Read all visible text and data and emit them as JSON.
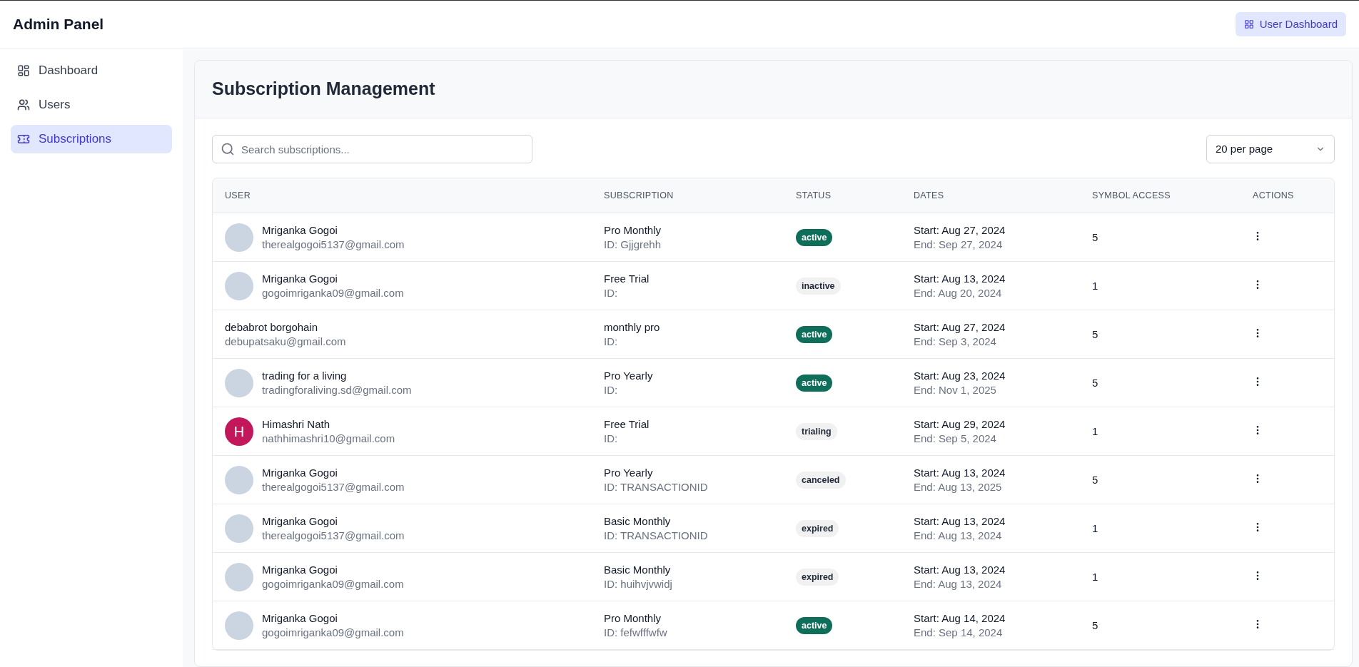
{
  "app": {
    "title": "Admin Panel",
    "header_button": "User Dashboard"
  },
  "sidebar": {
    "items": [
      {
        "label": "Dashboard",
        "selected": false
      },
      {
        "label": "Users",
        "selected": false
      },
      {
        "label": "Subscriptions",
        "selected": true
      }
    ]
  },
  "page": {
    "title": "Subscription Management",
    "search": {
      "placeholder": "Search subscriptions..."
    },
    "per_page": "20 per page"
  },
  "table": {
    "columns": [
      "USER",
      "SUBSCRIPTION",
      "STATUS",
      "DATES",
      "SYMBOL ACCESS",
      "ACTIONS"
    ],
    "rows": [
      {
        "avatar": {
          "kind": "photo"
        },
        "name": "Mriganka Gogoi",
        "email": "therealgogoi5137@gmail.com",
        "plan": "Pro Monthly",
        "plan_id": "ID: Gjjgrehh",
        "status": {
          "label": "active",
          "kind": "success"
        },
        "start": "Start: Aug 27, 2024",
        "end": "End: Sep 27, 2024",
        "symbol_access": "5"
      },
      {
        "avatar": {
          "kind": "photo"
        },
        "name": "Mriganka Gogoi",
        "email": "gogoimriganka09@gmail.com",
        "plan": "Free Trial",
        "plan_id": "ID:",
        "status": {
          "label": "inactive",
          "kind": "neutral"
        },
        "start": "Start: Aug 13, 2024",
        "end": "End: Aug 20, 2024",
        "symbol_access": "1"
      },
      {
        "avatar": {
          "kind": "none"
        },
        "name": "debabrot borgohain",
        "email": "debupatsaku@gmail.com",
        "plan": "monthly pro",
        "plan_id": "ID:",
        "status": {
          "label": "active",
          "kind": "success"
        },
        "start": "Start: Aug 27, 2024",
        "end": "End: Sep 3, 2024",
        "symbol_access": "5"
      },
      {
        "avatar": {
          "kind": "photo"
        },
        "name": "trading for a living",
        "email": "tradingforaliving.sd@gmail.com",
        "plan": "Pro Yearly",
        "plan_id": "ID:",
        "status": {
          "label": "active",
          "kind": "success"
        },
        "start": "Start: Aug 23, 2024",
        "end": "End: Nov 1, 2025",
        "symbol_access": "5"
      },
      {
        "avatar": {
          "kind": "initial",
          "letter": "H",
          "color": "#c2185b"
        },
        "name": "Himashri Nath",
        "email": "nathhimashri10@gmail.com",
        "plan": "Free Trial",
        "plan_id": "ID:",
        "status": {
          "label": "trialing",
          "kind": "neutral"
        },
        "start": "Start: Aug 29, 2024",
        "end": "End: Sep 5, 2024",
        "symbol_access": "1"
      },
      {
        "avatar": {
          "kind": "photo"
        },
        "name": "Mriganka Gogoi",
        "email": "therealgogoi5137@gmail.com",
        "plan": "Pro Yearly",
        "plan_id": "ID: TRANSACTIONID",
        "status": {
          "label": "canceled",
          "kind": "neutral"
        },
        "start": "Start: Aug 13, 2024",
        "end": "End: Aug 13, 2025",
        "symbol_access": "5"
      },
      {
        "avatar": {
          "kind": "photo"
        },
        "name": "Mriganka Gogoi",
        "email": "therealgogoi5137@gmail.com",
        "plan": "Basic Monthly",
        "plan_id": "ID: TRANSACTIONID",
        "status": {
          "label": "expired",
          "kind": "neutral"
        },
        "start": "Start: Aug 13, 2024",
        "end": "End: Aug 13, 2024",
        "symbol_access": "1"
      },
      {
        "avatar": {
          "kind": "photo"
        },
        "name": "Mriganka Gogoi",
        "email": "gogoimriganka09@gmail.com",
        "plan": "Basic Monthly",
        "plan_id": "ID: huihvjvwidj",
        "status": {
          "label": "expired",
          "kind": "neutral"
        },
        "start": "Start: Aug 13, 2024",
        "end": "End: Aug 13, 2024",
        "symbol_access": "1"
      },
      {
        "avatar": {
          "kind": "photo"
        },
        "name": "Mriganka Gogoi",
        "email": "gogoimriganka09@gmail.com",
        "plan": "Pro Monthly",
        "plan_id": "ID: fefwfffwfw",
        "status": {
          "label": "active",
          "kind": "success"
        },
        "start": "Start: Aug 14, 2024",
        "end": "End: Sep 14, 2024",
        "symbol_access": "5"
      }
    ]
  }
}
